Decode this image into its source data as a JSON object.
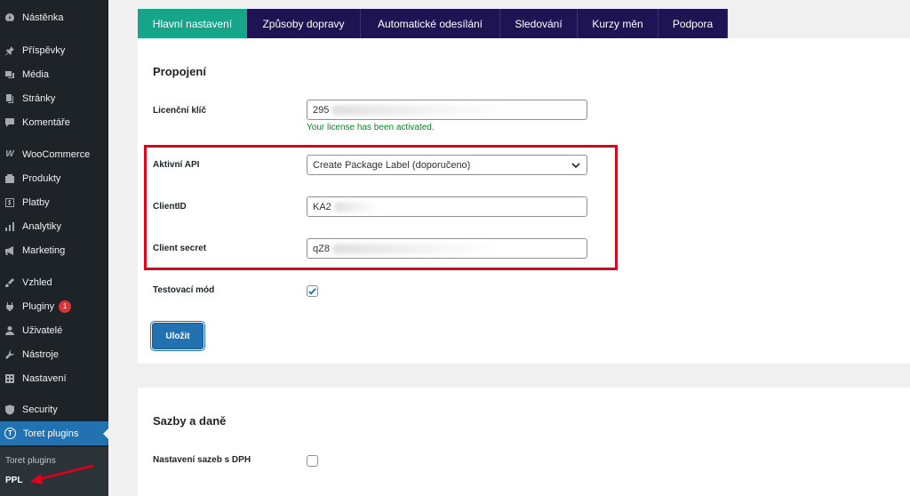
{
  "sidebar": {
    "items": [
      {
        "label": "Nástěnka",
        "icon": "dashboard-icon"
      },
      {
        "label": "Příspěvky",
        "icon": "pin-icon"
      },
      {
        "label": "Média",
        "icon": "media-icon"
      },
      {
        "label": "Stránky",
        "icon": "pages-icon"
      },
      {
        "label": "Komentáře",
        "icon": "comments-icon"
      },
      {
        "label": "WooCommerce",
        "icon": "woocommerce-icon"
      },
      {
        "label": "Produkty",
        "icon": "products-icon"
      },
      {
        "label": "Platby",
        "icon": "payments-icon"
      },
      {
        "label": "Analytiky",
        "icon": "analytics-icon"
      },
      {
        "label": "Marketing",
        "icon": "marketing-icon"
      },
      {
        "label": "Vzhled",
        "icon": "appearance-icon"
      },
      {
        "label": "Pluginy",
        "icon": "plugins-icon",
        "badge": "1"
      },
      {
        "label": "Uživatelé",
        "icon": "users-icon"
      },
      {
        "label": "Nástroje",
        "icon": "tools-icon"
      },
      {
        "label": "Nastavení",
        "icon": "settings-icon"
      },
      {
        "label": "Security",
        "icon": "shield-icon"
      },
      {
        "label": "Toret plugins",
        "icon": "toret-icon",
        "active": true
      }
    ],
    "submenu": {
      "parent": "Toret plugins",
      "current": "PPL"
    }
  },
  "tabs": [
    {
      "label": "Hlavní nastavení",
      "active": true
    },
    {
      "label": "Způsoby dopravy"
    },
    {
      "label": "Automatické odesílání"
    },
    {
      "label": "Sledování"
    },
    {
      "label": "Kurzy měn"
    },
    {
      "label": "Podpora"
    }
  ],
  "connection": {
    "title": "Propojení",
    "license_label": "Licenční klíč",
    "license_value": "295",
    "license_status": "Your license has been activated.",
    "api_label": "Aktivní API",
    "api_value": "Create Package Label (doporučeno)",
    "client_id_label": "ClientID",
    "client_id_value": "KA2",
    "client_secret_label": "Client secret",
    "client_secret_value": "qZ8",
    "test_mode_label": "Testovací mód",
    "test_mode_checked": true,
    "save_label": "Uložit"
  },
  "rates": {
    "title": "Sazby a daně",
    "vat_label": "Nastavení sazeb s DPH",
    "vat_checked": false
  },
  "colors": {
    "sidebar_bg": "#1d2327",
    "accent": "#2271b1",
    "tab_bg": "#1e1453",
    "tab_active": "#17a589",
    "annotation": "#e3001b",
    "success": "#008a20"
  }
}
